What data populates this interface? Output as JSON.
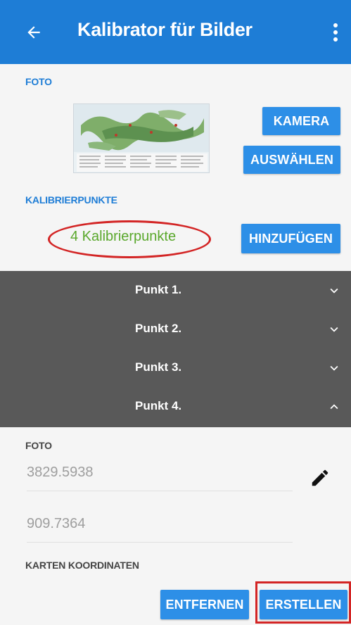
{
  "header": {
    "title": "Kalibrator für Bilder",
    "back_icon": "arrow-back-icon",
    "more_icon": "more-vert-icon",
    "color": "#1e7dd6"
  },
  "photo_section": {
    "label": "FOTO",
    "camera_button": "KAMERA",
    "select_button": "AUSWÄHLEN"
  },
  "calibration_section": {
    "label": "KALIBRIERPUNKTE",
    "count_text": "4 Kalibrierpunkte",
    "add_button": "HINZUFÜGEN"
  },
  "points": [
    {
      "label": "Punkt 1.",
      "expanded": false
    },
    {
      "label": "Punkt 2.",
      "expanded": false
    },
    {
      "label": "Punkt 3.",
      "expanded": false
    },
    {
      "label": "Punkt 4.",
      "expanded": true
    }
  ],
  "point_detail": {
    "photo_label": "FOTO",
    "x_value": "3829.5938",
    "y_value": "909.7364",
    "edit_icon": "pencil-icon",
    "map_coords_label": "KARTEN KOORDINATEN"
  },
  "actions": {
    "remove_button": "ENTFERNEN",
    "create_button": "ERSTELLEN"
  },
  "colors": {
    "accent": "#2d8fe7",
    "count_text": "#5aa82c",
    "highlight": "#d32525",
    "accordion_bg": "#595959"
  }
}
